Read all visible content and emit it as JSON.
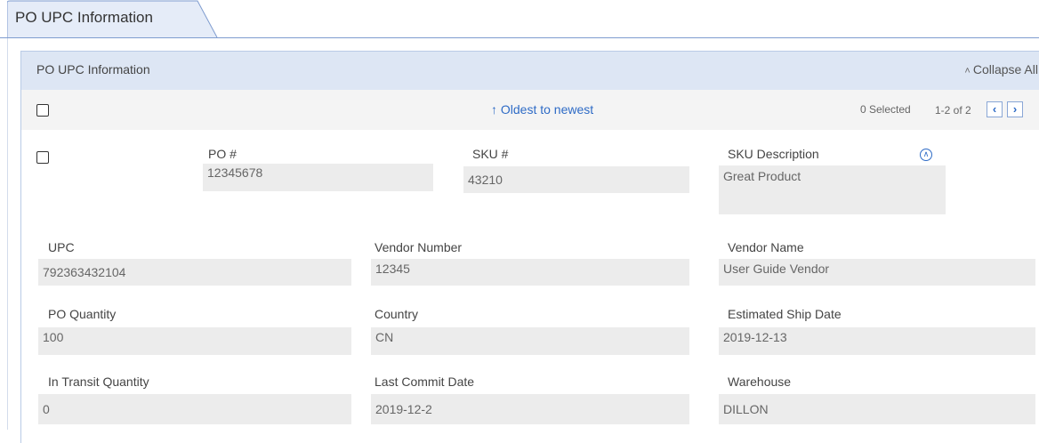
{
  "tab": {
    "label": "PO UPC Information"
  },
  "panel": {
    "title": "PO UPC Information",
    "collapse_label": "Collapse All"
  },
  "toolbar": {
    "sort_label": "Oldest to newest",
    "selected": "0 Selected",
    "page_count": "1-2 of 2"
  },
  "record": {
    "po_label": "PO #",
    "po_value": "12345678",
    "sku_label": "SKU #",
    "sku_value": "43210",
    "sku_desc_label": "SKU Description",
    "sku_desc_value": "Great Product",
    "upc_label": "UPC",
    "upc_value": "792363432104",
    "vendor_number_label": "Vendor Number",
    "vendor_number_value": "12345",
    "vendor_name_label": "Vendor Name",
    "vendor_name_value": "User Guide Vendor",
    "po_qty_label": "PO Quantity",
    "po_qty_value": "100",
    "country_label": "Country",
    "country_value": "CN",
    "ship_date_label": "Estimated Ship Date",
    "ship_date_value": "2019-12-13",
    "transit_label": "In Transit Quantity",
    "transit_value": "0",
    "commit_label": "Last Commit Date",
    "commit_value": "2019-12-2",
    "warehouse_label": "Warehouse",
    "warehouse_value": "DILLON"
  }
}
